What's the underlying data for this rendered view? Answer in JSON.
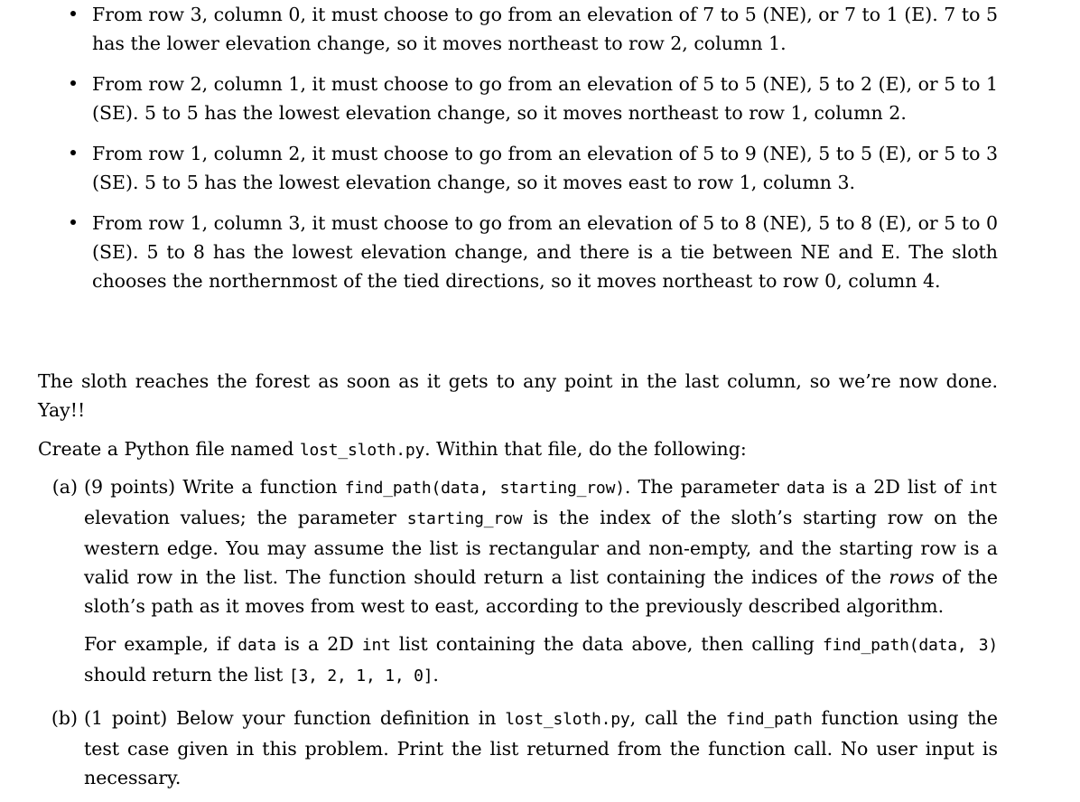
{
  "document": {
    "type": "assignment-problem-statement",
    "font_style": "latex-serif",
    "text_color": "#000000",
    "background_color": "#ffffff"
  },
  "bullets": [
    {
      "id": "bullet-row3-col0",
      "segments": [
        {
          "kind": "text",
          "value": "From row 3, column 0, it must choose to go from an elevation of 7 to 5 (NE), or 7 to 1 (E). 7 to 5 has the lower elevation change, so it moves northeast to row 2, column 1."
        }
      ]
    },
    {
      "id": "bullet-row2-col1",
      "segments": [
        {
          "kind": "text",
          "value": "From row 2, column 1, it must choose to go from an elevation of 5 to 5 (NE), 5 to 2 (E), or 5 to 1 (SE). 5 to 5 has the lowest elevation change, so it moves northeast to row 1, column 2."
        }
      ]
    },
    {
      "id": "bullet-row1-col2",
      "segments": [
        {
          "kind": "text",
          "value": "From row 1, column 2, it must choose to go from an elevation of 5 to 9 (NE), 5 to 5 (E), or 5 to 3 (SE). 5 to 5 has the lowest elevation change, so it moves east to row 1, column 3."
        }
      ]
    },
    {
      "id": "bullet-row1-col3",
      "segments": [
        {
          "kind": "text",
          "value": "From row 1, column 3, it must choose to go from an elevation of 5 to 8 (NE), 5 to 8 (E), or 5 to 0 (SE). 5 to 8 has the lowest elevation change, and there is a tie between NE and E. The sloth chooses the northernmost of the tied directions, so it moves northeast to row 0, column 4."
        }
      ]
    }
  ],
  "paragraph_done": {
    "text": "The sloth reaches the forest as soon as it gets to any point in the last column, so we’re now done. Yay!!"
  },
  "paragraph_create": {
    "before": "Create a Python file named ",
    "code_filename": "lost_sloth.py",
    "after": ". Within that file, do the following:"
  },
  "enumerate": [
    {
      "label": "(a)",
      "points": "(9 points)",
      "t1": " Write a function ",
      "code1": "find_path(data, starting_row)",
      "t2": ". The parameter ",
      "code2": "data",
      "t3": " is a 2D list of ",
      "code3": "int",
      "t4": " elevation values; the parameter ",
      "code4": "starting_row",
      "t5": " is the index of the sloth’s starting row on the western edge. You may assume the list is rectangular and non-empty, and the starting row is a valid row in the list. The function should return a list containing the indices of the ",
      "em1": "rows",
      "t6": " of the sloth’s path as it moves from west to east, according to the previously described algorithm.",
      "sub": {
        "t1": "For example, if ",
        "code1": "data",
        "t2": " is a 2D ",
        "code2": "int",
        "t3": " list containing the data above, then calling ",
        "code3": "find_path(data, 3)",
        "t4": " should return the list ",
        "code4": "[3, 2, 1, 1, 0]",
        "t5": "."
      }
    },
    {
      "label": "(b)",
      "points": "(1 point)",
      "t1": " Below your function definition in ",
      "code1": "lost_sloth.py",
      "t2": ", call the ",
      "code2": "find_path",
      "t3": " function using the test case given in this problem. Print the list returned from the function call. No user input is necessary."
    }
  ]
}
